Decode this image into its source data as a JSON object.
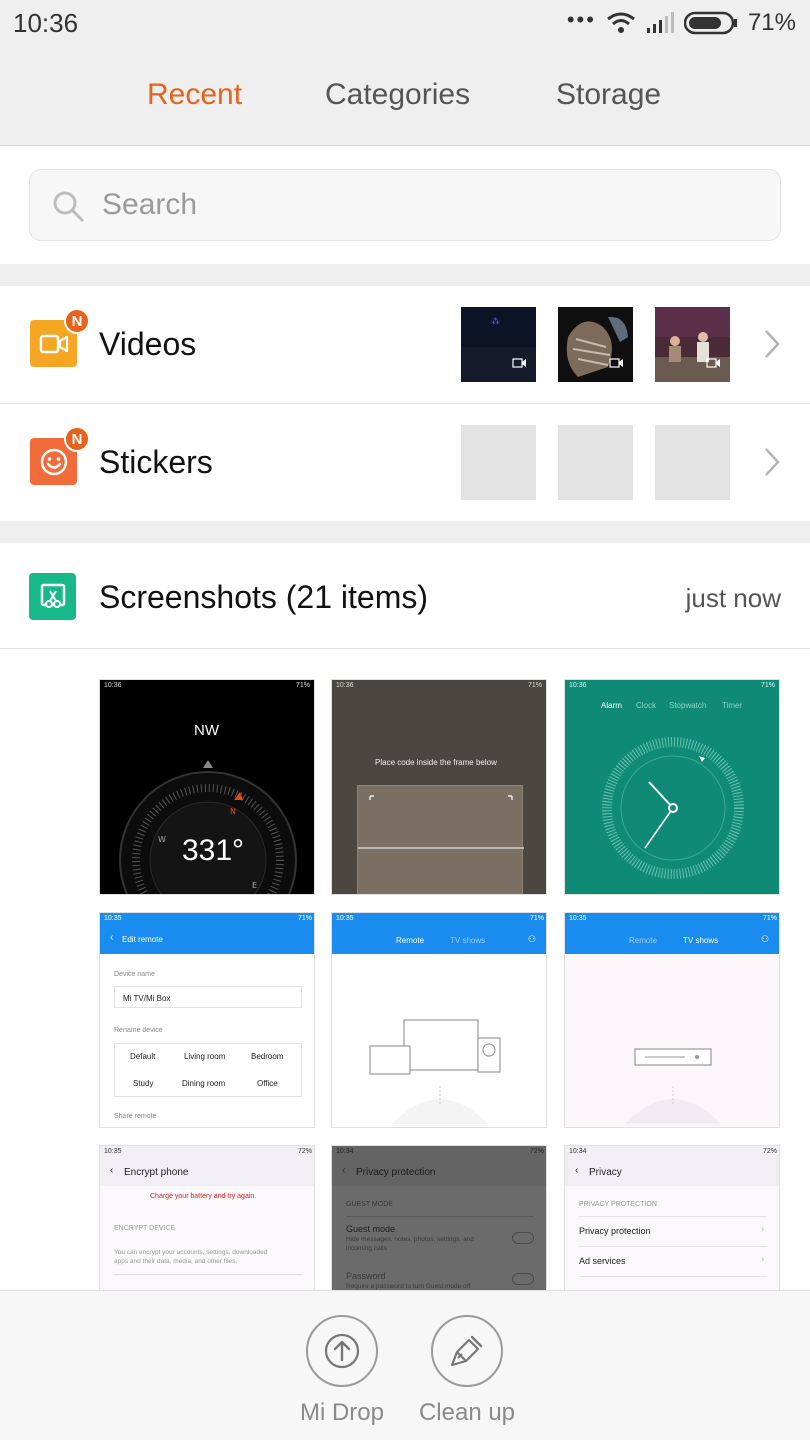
{
  "status_bar": {
    "time": "10:36",
    "battery": "71%"
  },
  "tabs": [
    {
      "label": "Recent",
      "active": true
    },
    {
      "label": "Categories",
      "active": false
    },
    {
      "label": "Storage",
      "active": false
    }
  ],
  "search": {
    "placeholder": "Search"
  },
  "rows": {
    "videos": {
      "label": "Videos",
      "badge": "N"
    },
    "stickers": {
      "label": "Stickers",
      "badge": "N"
    }
  },
  "screenshots": {
    "title": "Screenshots (21 items)",
    "time": "just now"
  },
  "thumbnails": {
    "compass": {
      "time": "10:36",
      "battery": "71%",
      "heading": "NW",
      "degrees": "331°"
    },
    "scanner": {
      "time": "10:36",
      "battery": "71%",
      "hint": "Place code inside the frame below"
    },
    "clock": {
      "time": "10:36",
      "battery": "71%",
      "tabs": [
        "Alarm",
        "Clock",
        "Stopwatch",
        "Timer"
      ]
    },
    "edit_remote": {
      "time": "10:35",
      "battery": "71%",
      "title": "Edit remote",
      "device_name_label": "Device name",
      "device_name": "Mi TV/Mi Box",
      "rename_label": "Rename device",
      "options": [
        "Default",
        "Living room",
        "Bedroom",
        "Study",
        "Dining room",
        "Office"
      ],
      "share_label": "Share remote"
    },
    "remote_tab": {
      "time": "10:35",
      "battery": "71%",
      "tabs": [
        "Remote",
        "TV shows"
      ]
    },
    "tvshows_tab": {
      "time": "10:35",
      "battery": "71%",
      "tabs": [
        "Remote",
        "TV shows"
      ]
    },
    "encrypt": {
      "time": "10:35",
      "battery": "72%",
      "title": "Encrypt phone",
      "warning": "Charge your battery and try again.",
      "section": "ENCRYPT DEVICE",
      "desc1": "You can encrypt your accounts, settings, downloaded",
      "desc2": "apps and their data, media, and other files."
    },
    "privacy_protection": {
      "time": "10:34",
      "battery": "72%",
      "title": "Privacy protection",
      "section": "GUEST MODE",
      "item1": "Guest mode",
      "item1_desc1": "Hide messages, notes, photos, settings, and",
      "item1_desc2": "incoming calls",
      "item2": "Password",
      "item2_desc": "Require a password to turn Guest mode off"
    },
    "privacy": {
      "time": "10:34",
      "battery": "72%",
      "title": "Privacy",
      "section": "PRIVACY PROTECTION",
      "item1": "Privacy protection",
      "item2": "Ad services"
    }
  },
  "bottom_actions": {
    "mi_drop": "Mi Drop",
    "clean_up": "Clean up"
  },
  "colors": {
    "accent": "#e8621b",
    "videos_icon": "#f5a623",
    "stickers_icon": "#f26b3a",
    "screenshots_icon": "#17b98b",
    "blue": "#1a8cf0",
    "teal": "#0e8a76"
  }
}
